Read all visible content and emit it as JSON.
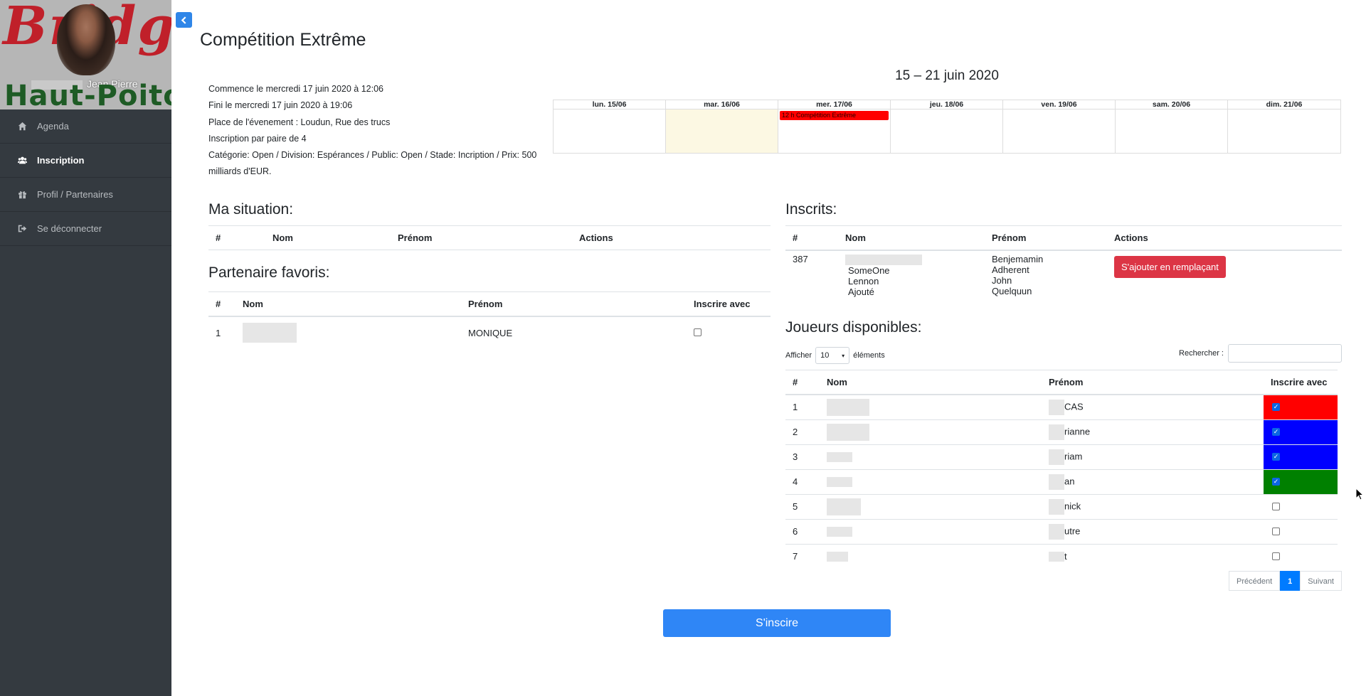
{
  "sidebar": {
    "logo": {
      "top_text": "Bridge",
      "region": "Haut-Poitou",
      "user_name": "Jean Pierre"
    },
    "items": [
      {
        "label": "Agenda",
        "icon": "home-icon",
        "active": false
      },
      {
        "label": "Inscription",
        "icon": "users-icon",
        "active": true
      },
      {
        "label": "Profil / Partenaires",
        "icon": "gift-icon",
        "active": false
      },
      {
        "label": "Se déconnecter",
        "icon": "sign-out-icon",
        "active": false
      }
    ]
  },
  "page": {
    "title": "Compétition Extrême"
  },
  "event": {
    "starts": "Commence le mercredi 17 juin 2020 à 12:06",
    "ends": "Fini le mercredi 17 juin 2020 à 19:06",
    "place": "Place de l'évenement : Loudun, Rue des trucs",
    "pairing": "Inscription par paire de 4",
    "category": "Catégorie: Open / Division: Espérances / Public: Open / Stade: Incription / Prix: 500 milliards d'EUR."
  },
  "calendar": {
    "title": "15 – 21 juin 2020",
    "days": [
      "lun. 15/06",
      "mar. 16/06",
      "mer. 17/06",
      "jeu. 18/06",
      "ven. 19/06",
      "sam. 20/06",
      "dim. 21/06"
    ],
    "today_index": 1,
    "event": {
      "day_index": 2,
      "label": "12 h Compétition Extrême",
      "color": "#ff0000"
    }
  },
  "situation": {
    "title": "Ma situation:",
    "headers": [
      "#",
      "Nom",
      "Prénom",
      "Actions"
    ]
  },
  "favoris": {
    "title": "Partenaire favoris:",
    "headers": [
      "#",
      "Nom",
      "Prénom",
      "Inscrire avec"
    ],
    "rows": [
      {
        "num": "1",
        "prenom": "MONIQUE",
        "checked": false
      }
    ]
  },
  "inscrits": {
    "title": "Inscrits:",
    "headers": [
      "#",
      "Nom",
      "Prénom",
      "Actions"
    ],
    "rows": [
      {
        "num": "387",
        "noms": [
          "SomeOne",
          "Lennon",
          "Ajouté"
        ],
        "prenoms": [
          "Benjemamin",
          "Adherent",
          "John",
          "Quelquun"
        ],
        "action": "S'ajouter en remplaçant"
      }
    ]
  },
  "dispo": {
    "title": "Joueurs disponibles:",
    "show_label": "Afficher",
    "show_value": "10",
    "elements_label": "éléments",
    "search_label": "Rechercher :",
    "headers": [
      "#",
      "Nom",
      "Prénom",
      "Inscrire avec"
    ],
    "rows": [
      {
        "num": "1",
        "prenom": "CAS",
        "checked": true,
        "color": "#ff0000"
      },
      {
        "num": "2",
        "prenom": "rianne",
        "checked": true,
        "color": "#0000ff"
      },
      {
        "num": "3",
        "prenom": "riam",
        "checked": true,
        "color": "#0000ff"
      },
      {
        "num": "4",
        "prenom": "an",
        "checked": true,
        "color": "#008000"
      },
      {
        "num": "5",
        "prenom": "nick",
        "checked": false,
        "color": ""
      },
      {
        "num": "6",
        "prenom": "utre",
        "checked": false,
        "color": ""
      },
      {
        "num": "7",
        "prenom": "t",
        "checked": false,
        "color": ""
      }
    ],
    "pagination": {
      "prev": "Précédent",
      "page": "1",
      "next": "Suivant"
    }
  },
  "submit_label": "S'inscire",
  "colors": {
    "sidebar": "#343a40",
    "primary": "#2f86f6",
    "danger": "#dc3545",
    "today": "#fcf8e3"
  }
}
